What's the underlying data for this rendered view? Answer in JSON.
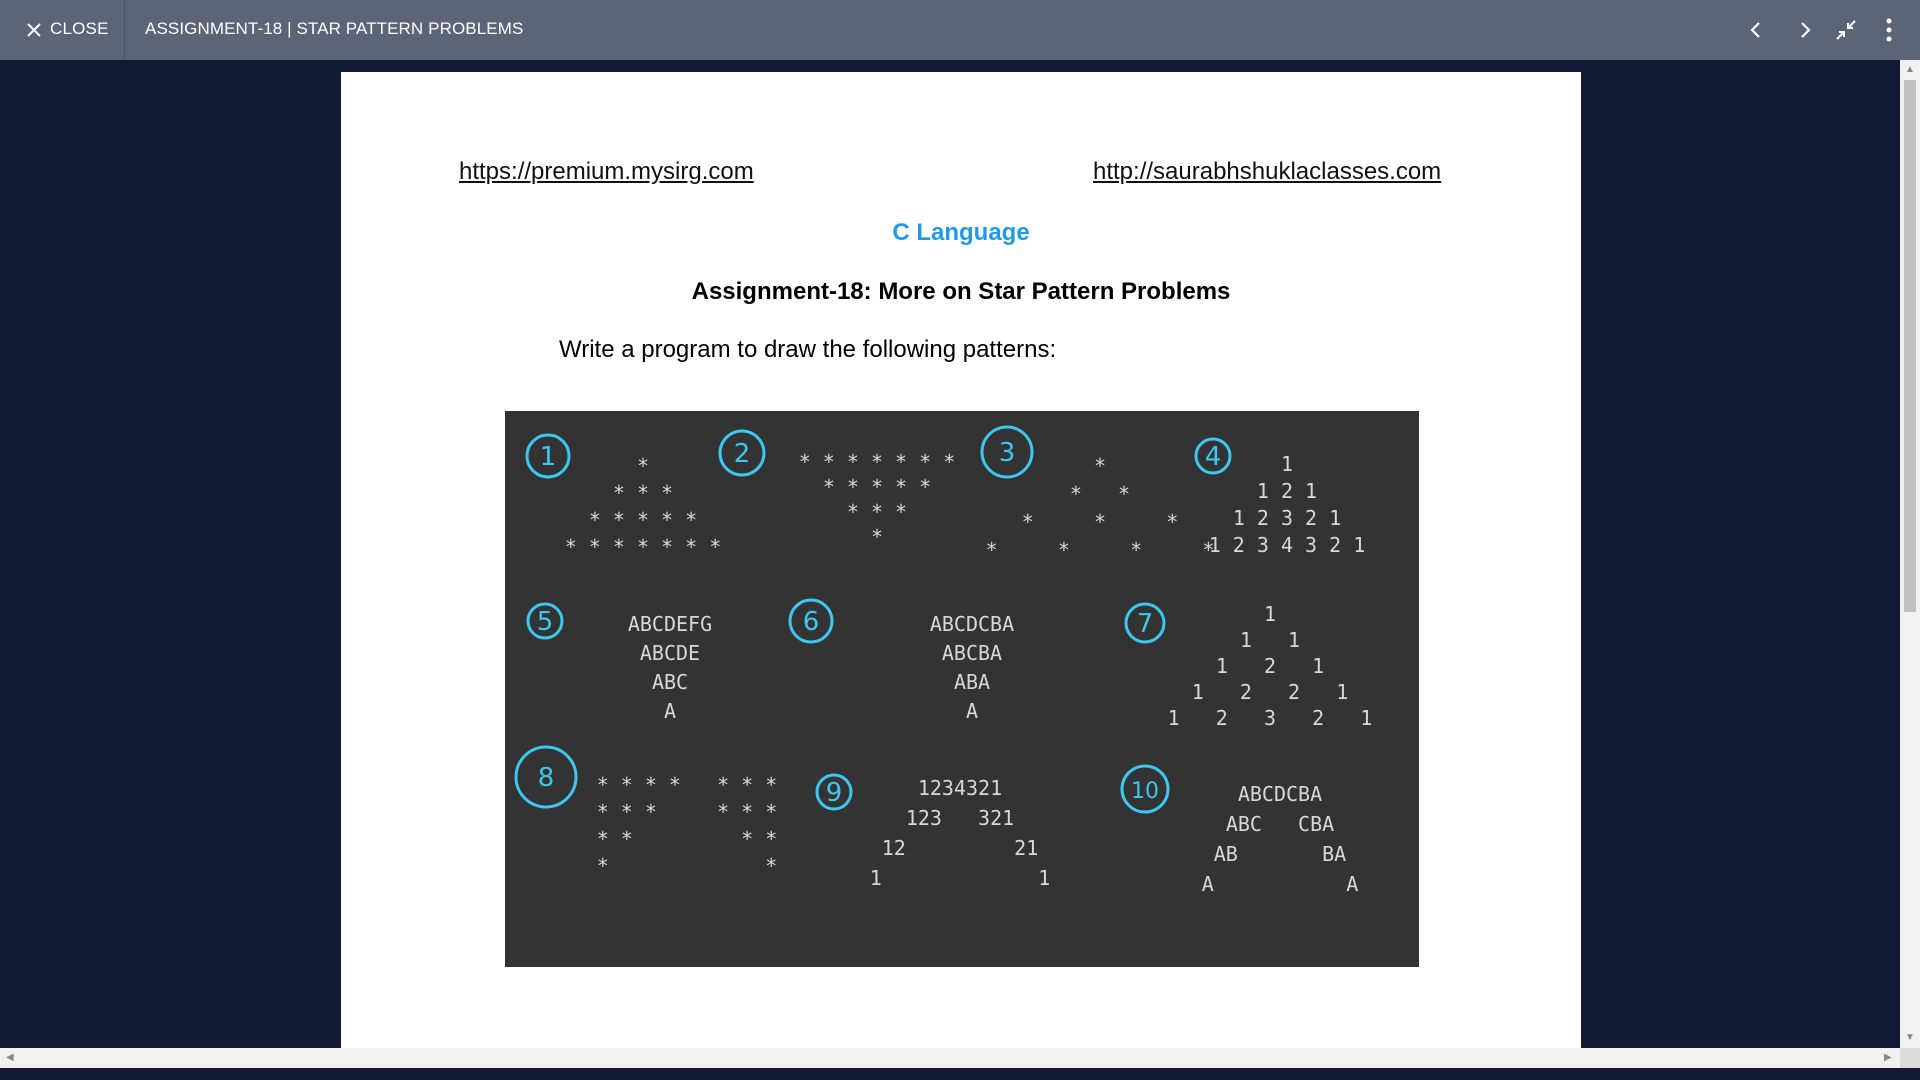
{
  "topbar": {
    "close_label": "CLOSE",
    "title": "ASSIGNMENT-18 | STAR PATTERN PROBLEMS"
  },
  "icons": {
    "close": "close-icon",
    "prev": "chevron-left-icon",
    "next": "chevron-right-icon",
    "exit_fullscreen": "exit-fullscreen-icon",
    "menu": "more-vertical-icon"
  },
  "document": {
    "link_left": "https://premium.mysirg.com",
    "link_right": "http://saurabhshuklaclasses.com",
    "subject": "C Language",
    "assignment": "Assignment-18: More on Star Pattern Problems",
    "instruction": "Write a program to draw the following patterns:"
  },
  "board": {
    "background": "#333333",
    "circle_color": "#3cc8f0",
    "chalk_color": "#d8d8d8",
    "patterns": [
      {
        "num": "1",
        "rows": [
          "*",
          "* * *",
          "* * * * *",
          "* * * * * * *"
        ]
      },
      {
        "num": "2",
        "rows": [
          "* * * * * * *",
          "* * * * *",
          "* * *",
          "*"
        ]
      },
      {
        "num": "3",
        "rows": [
          "*",
          "*   *",
          "*     *     *",
          "*     *     *     *"
        ]
      },
      {
        "num": "4",
        "rows": [
          "1",
          "1 2 1",
          "1 2 3 2 1",
          "1 2 3 4 3 2 1"
        ]
      },
      {
        "num": "5",
        "rows": [
          "ABCDEFG",
          "ABCDE",
          "ABC",
          "A"
        ]
      },
      {
        "num": "6",
        "rows": [
          "ABCDCBA",
          "ABCBA",
          "ABA",
          "A"
        ]
      },
      {
        "num": "7",
        "rows": [
          "1",
          "1   1",
          "1   2   1",
          "1   2   2   1",
          "1   2   3   2   1"
        ]
      },
      {
        "num": "8",
        "rows": [
          "* * * *   * * *",
          "* * *     * * *",
          "* *         * *",
          "*             *"
        ]
      },
      {
        "num": "9",
        "rows": [
          "1234321",
          "123   321",
          "12         21",
          "1             1"
        ]
      },
      {
        "num": "10",
        "rows": [
          "ABCDCBA",
          "ABC   CBA",
          "AB       BA",
          "A           A"
        ]
      }
    ]
  }
}
